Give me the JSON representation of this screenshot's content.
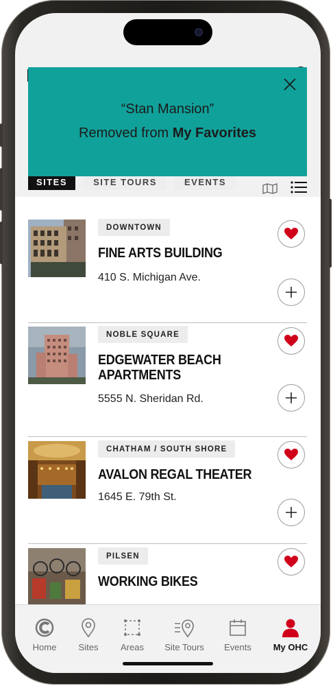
{
  "toast": {
    "name_line": "“Stan Mansion”",
    "message_prefix": "Removed from ",
    "message_bold": "My Favorites",
    "close_icon": "close-icon"
  },
  "tabs": {
    "sites": "SITES",
    "site_tours": "SITE TOURS",
    "events": "EVENTS"
  },
  "sites": [
    {
      "neighborhood": "DOWNTOWN",
      "title": "FINE ARTS BUILDING",
      "address": "410 S. Michigan Ave.",
      "favorited": true
    },
    {
      "neighborhood": "NOBLE SQUARE",
      "title": "EDGEWATER BEACH APARTMENTS",
      "address": "5555 N. Sheridan Rd.",
      "favorited": true
    },
    {
      "neighborhood": "CHATHAM / SOUTH SHORE",
      "title": "AVALON REGAL THEATER",
      "address": "1645 E. 79th St.",
      "favorited": true
    },
    {
      "neighborhood": "PILSEN",
      "title": "WORKING BIKES",
      "address": "",
      "favorited": true
    }
  ],
  "tabbar": {
    "home": "Home",
    "sites": "Sites",
    "areas": "Areas",
    "site_tours": "Site Tours",
    "events": "Events",
    "my_ohc": "My OHC",
    "active": "my_ohc"
  },
  "colors": {
    "toast_bg": "#10a19a",
    "heart": "#d0021b",
    "active_tab": "#111111",
    "my_ohc_icon": "#d0021b"
  }
}
